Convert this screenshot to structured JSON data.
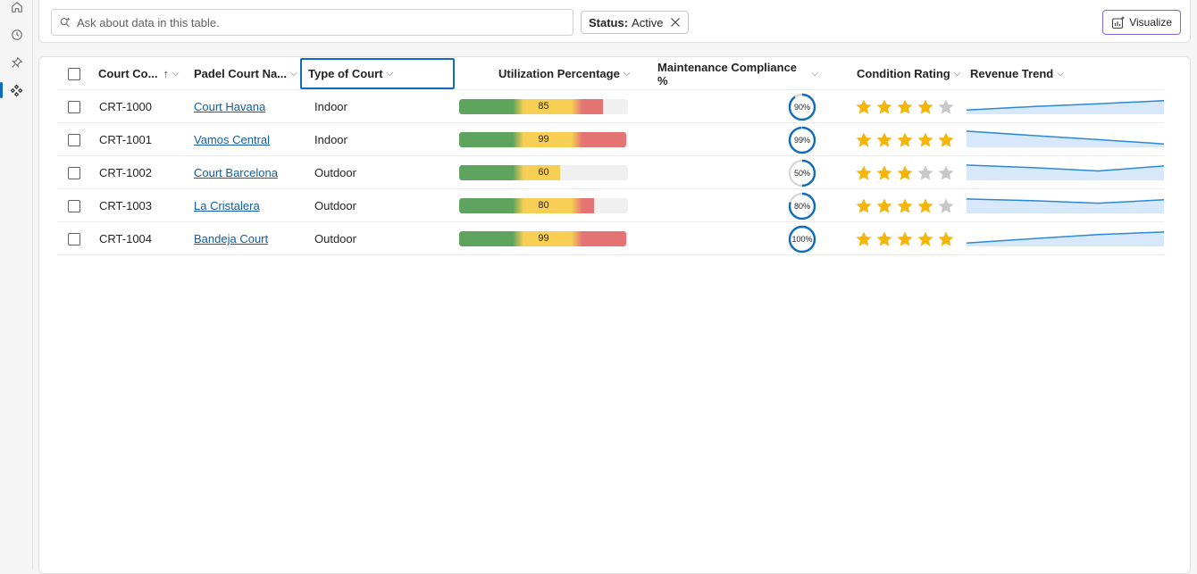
{
  "search": {
    "placeholder": "Ask about data in this table."
  },
  "filter_chip": {
    "key": "Status:",
    "value": "Active"
  },
  "toolbar": {
    "visualize_label": "Visualize"
  },
  "colors": {
    "accent": "#0f6cbd",
    "link": "#115ea3",
    "bar_green": "#5ea35e",
    "bar_yellow": "#f6cf54",
    "bar_red": "#e47373",
    "star_on": "#f5b50a",
    "star_off": "#c8c8c8",
    "trend_line": "#2b88d8",
    "trend_fill": "#d6e8f9"
  },
  "columns": [
    {
      "label": "Court Co...",
      "sort": "↑"
    },
    {
      "label": "Padel Court Na..."
    },
    {
      "label": "Type of Court"
    },
    {
      "label": "Utilization Percentage"
    },
    {
      "label": "Maintenance Compliance %"
    },
    {
      "label": "Condition Rating"
    },
    {
      "label": "Revenue Trend"
    }
  ],
  "rows": [
    {
      "code": "CRT-1000",
      "name": "Court Havana",
      "type": "Indoor",
      "utilization": 85,
      "compliance": "90%",
      "compliance_value": 90,
      "rating": 4,
      "trend": [
        0.25,
        0.45,
        0.62,
        0.8
      ]
    },
    {
      "code": "CRT-1001",
      "name": "Vamos Central",
      "type": "Indoor",
      "utilization": 99,
      "compliance": "99%",
      "compliance_value": 99,
      "rating": 5,
      "trend": [
        0.95,
        0.7,
        0.45,
        0.2
      ]
    },
    {
      "code": "CRT-1002",
      "name": "Court Barcelona",
      "type": "Outdoor",
      "utilization": 60,
      "compliance": "50%",
      "compliance_value": 50,
      "rating": 3,
      "trend": [
        0.9,
        0.75,
        0.55,
        0.85
      ]
    },
    {
      "code": "CRT-1003",
      "name": "La Cristalera",
      "type": "Outdoor",
      "utilization": 80,
      "compliance": "80%",
      "compliance_value": 80,
      "rating": 4,
      "trend": [
        0.85,
        0.75,
        0.6,
        0.8
      ]
    },
    {
      "code": "CRT-1004",
      "name": "Bandeja Court",
      "type": "Outdoor",
      "utilization": 99,
      "compliance": "100%",
      "compliance_value": 100,
      "rating": 5,
      "trend": [
        0.2,
        0.45,
        0.7,
        0.85
      ]
    }
  ]
}
